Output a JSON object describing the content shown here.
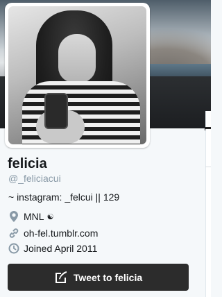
{
  "profile": {
    "name": "felicia",
    "handle": "@_feliciacui",
    "bio": "~ instagram: _felcui || 129",
    "location": "MNL",
    "location_glyph": "☯",
    "website": "oh-fel.tumblr.com",
    "joined": "Joined April 2011"
  },
  "tweet_button": {
    "label": "Tweet to felicia"
  },
  "icons": {
    "location": "map-pin-icon",
    "website": "link-icon",
    "joined": "clock-icon",
    "tweet": "compose-quill-icon"
  },
  "colors": {
    "button_bg": "#2c2c2c",
    "handle": "#8899a6",
    "icon": "#8899a6"
  }
}
